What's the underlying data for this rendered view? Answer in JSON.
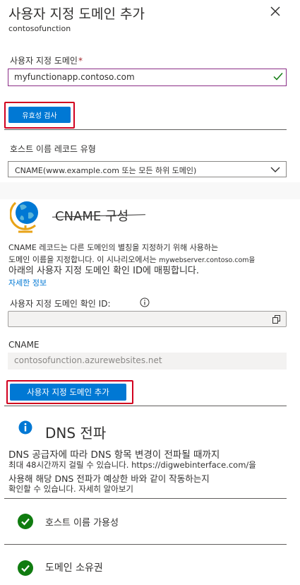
{
  "header": {
    "title": "사용자 지정 도메인 추가",
    "subtitle": "contosofunction",
    "close_icon": "close-icon"
  },
  "custom_domain": {
    "label": "사용자 지정 도메인",
    "required_mark": "*",
    "value": "myfunctionapp.contoso.com",
    "valid_icon": "check-icon"
  },
  "validate_button": {
    "label": "유효성 검사"
  },
  "record_type": {
    "label": "호스트 이름 레코드 유형",
    "selected": "CNAME(www.example.com 또는 모든 하위 도메인)"
  },
  "cname_section": {
    "icon": "globe-icon",
    "title": "CNAME 구성",
    "line1": "CNAME 레코드는 다른 도메인의 별칭을 지정하기 위해 사용하는",
    "line2a": "도메인 이름을 지정합니다. 이 시나리오에서는 ",
    "line2b": "mywebserver.contoso.com을",
    "line3": "아래의 사용자 지정 도메인 확인 ID에 매핑합니다.",
    "learn_more": "자세한 정보",
    "verification_label": "사용자 지정 도메인 확인 ID:",
    "verification_value": "",
    "cname_label": "CNAME",
    "cname_value": "contosofunction.azurewebsites.net"
  },
  "add_button": {
    "label": "사용자 지정 도메인 추가"
  },
  "dns": {
    "icon": "info-icon",
    "title": "DNS 전파",
    "line1": "DNS 공급자에 따라 DNS 항목 변경이 전파될 때까지",
    "line2": "최대 48시간까지 걸릴 수 있습니다. https://digwebinterface.com/을",
    "line3": "사용해 해당 DNS 전파가 예상한 바와 같이 작동하는지",
    "line4": "확인할 수 있습니다. 자세히 알아보기"
  },
  "checks": [
    {
      "label": "호스트 이름 가용성",
      "status": "success"
    },
    {
      "label": "도메인 소유권",
      "status": "success"
    }
  ],
  "colors": {
    "accent": "#0078d4",
    "highlight": "#d1001f",
    "success": "#107c10",
    "input_focus": "#8a2d86"
  }
}
